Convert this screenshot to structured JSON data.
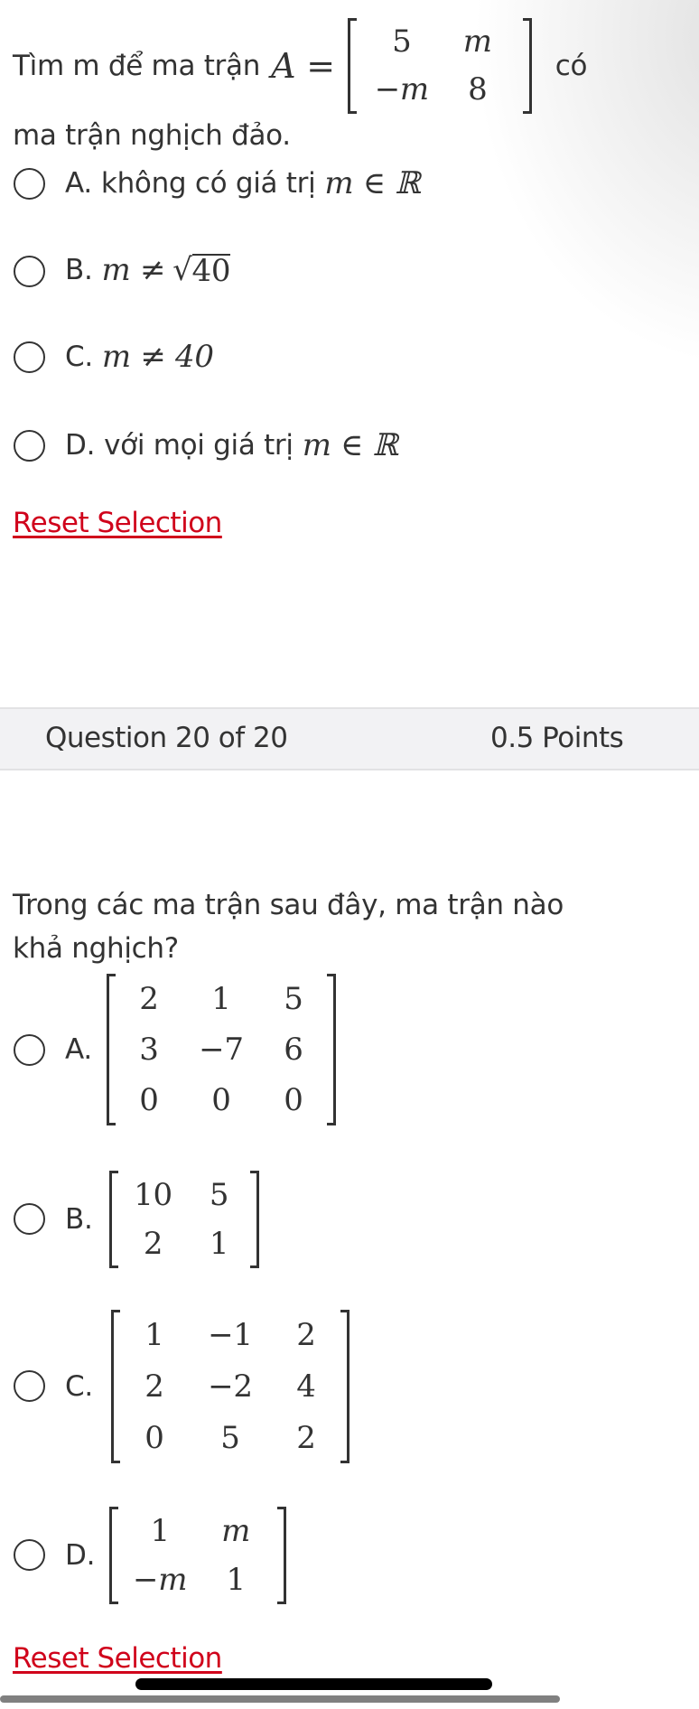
{
  "question19": {
    "prompt_before": "Tìm m để ma trận",
    "matrix_name": "A",
    "equals": "=",
    "matrix": [
      [
        "5",
        "m"
      ],
      [
        "−m",
        "8"
      ]
    ],
    "prompt_after": "có",
    "prompt_line2": "ma trận nghịch đảo.",
    "options": [
      {
        "label": "A.",
        "text": "không có giá trị",
        "math": "m ∈ ℝ"
      },
      {
        "label": "B.",
        "math_pre": "m ≠ ",
        "sqrt_symbol": "√",
        "sqrt_arg": "40"
      },
      {
        "label": "C.",
        "math": "m ≠ 40"
      },
      {
        "label": "D.",
        "text": "với mọi giá trị",
        "math": "m ∈ ℝ"
      }
    ],
    "reset_label": "Reset Selection"
  },
  "header": {
    "question_counter": "Question 20 of 20",
    "points": "0.5 Points"
  },
  "question20": {
    "prompt_line1": "Trong các ma trận sau đây, ma trận nào",
    "prompt_line2": "khả nghịch?",
    "options": [
      {
        "label": "A.",
        "matrix": [
          [
            "2",
            "1",
            "5"
          ],
          [
            "3",
            "−7",
            "6"
          ],
          [
            "0",
            "0",
            "0"
          ]
        ]
      },
      {
        "label": "B.",
        "matrix": [
          [
            "10",
            "5"
          ],
          [
            "2",
            "1"
          ]
        ]
      },
      {
        "label": "C.",
        "matrix": [
          [
            "1",
            "−1",
            "2"
          ],
          [
            "2",
            "−2",
            "4"
          ],
          [
            "0",
            "5",
            "2"
          ]
        ]
      },
      {
        "label": "D.",
        "matrix": [
          [
            "1",
            "m"
          ],
          [
            "−m",
            "1"
          ]
        ]
      }
    ],
    "reset_label": "Reset Selection"
  },
  "colors": {
    "text": "#333333",
    "link_red": "#d0021b",
    "header_bg": "#f2f2f4"
  }
}
